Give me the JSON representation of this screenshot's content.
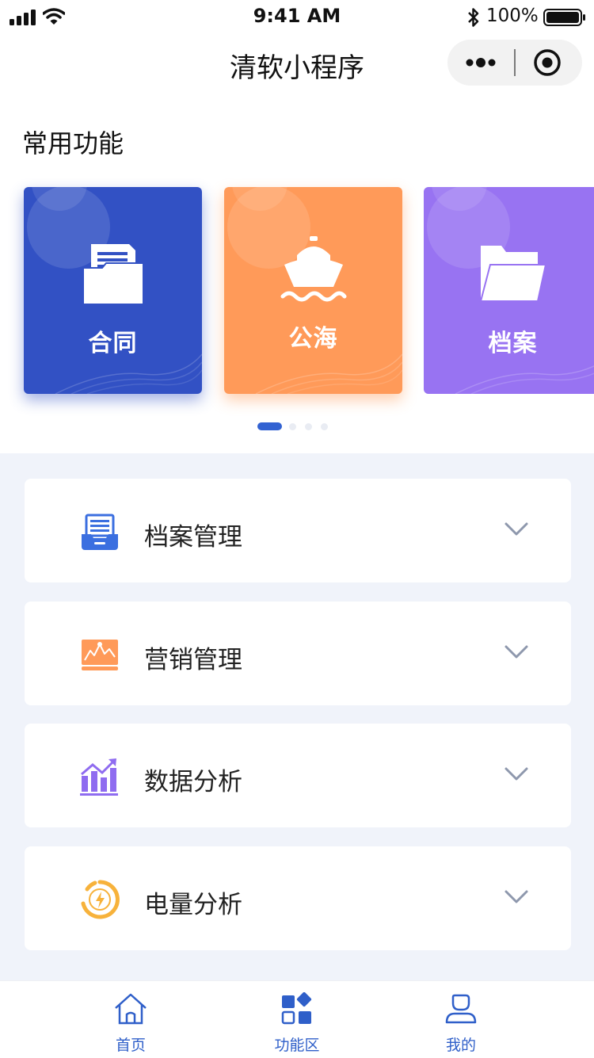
{
  "status_bar": {
    "time": "9:41 AM",
    "battery": "100%"
  },
  "nav": {
    "title": "清软小程序"
  },
  "common": {
    "title": "常用功能",
    "cards": [
      {
        "label": "合同",
        "icon": "folder-document-icon",
        "color": "#3251c4"
      },
      {
        "label": "公海",
        "icon": "ship-icon",
        "color": "#ff9a59"
      },
      {
        "label": "档案",
        "icon": "folder-icon",
        "color": "#9873f2"
      }
    ],
    "pager": {
      "current": 1,
      "total": 4
    }
  },
  "menu": [
    {
      "label": "档案管理",
      "icon": "archive-icon",
      "color": "#3b6fe0"
    },
    {
      "label": "营销管理",
      "icon": "marketing-chart-icon",
      "color": "#ff9a59"
    },
    {
      "label": "数据分析",
      "icon": "data-trend-icon",
      "color": "#8f6cf0"
    },
    {
      "label": "电量分析",
      "icon": "power-gauge-icon",
      "color": "#f7b23b"
    }
  ],
  "tabbar": {
    "active_color": "#2f5fc9",
    "tabs": [
      {
        "label": "首页",
        "icon": "home-icon"
      },
      {
        "label": "功能区",
        "icon": "grid-icon"
      },
      {
        "label": "我的",
        "icon": "user-icon"
      }
    ]
  }
}
